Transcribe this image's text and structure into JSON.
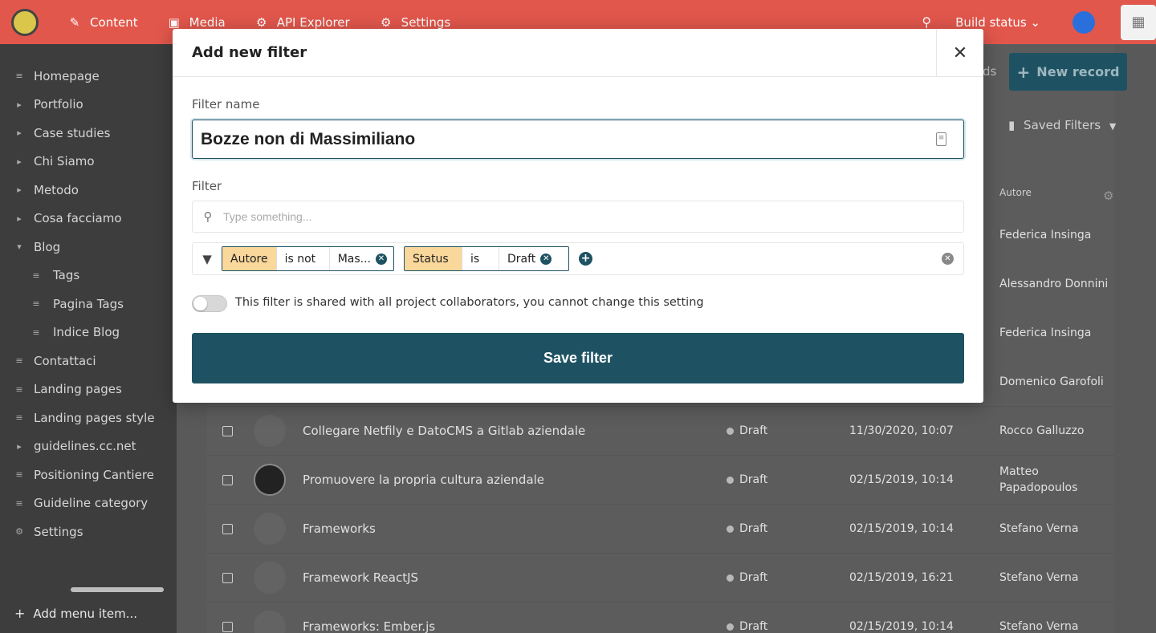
{
  "topbar": {
    "nav": [
      {
        "label": "Content",
        "icon": "content-icon"
      },
      {
        "label": "Media",
        "icon": "media-icon"
      },
      {
        "label": "API Explorer",
        "icon": "api-explorer-icon"
      },
      {
        "label": "Settings",
        "icon": "settings-icon"
      }
    ],
    "build_status": "Build status"
  },
  "sidebar": {
    "items": [
      {
        "label": "Homepage",
        "marker": "≡"
      },
      {
        "label": "Portfolio",
        "marker": "▸"
      },
      {
        "label": "Case studies",
        "marker": "▸"
      },
      {
        "label": "Chi Siamo",
        "marker": "▸"
      },
      {
        "label": "Metodo",
        "marker": "▸"
      },
      {
        "label": "Cosa facciamo",
        "marker": "▸"
      },
      {
        "label": "Blog",
        "marker": "▾"
      },
      {
        "label": "Tags",
        "marker": "≡",
        "sub": true
      },
      {
        "label": "Pagina Tags",
        "marker": "≡",
        "sub": true
      },
      {
        "label": "Indice Blog",
        "marker": "≡",
        "sub": true
      },
      {
        "label": "Contattaci",
        "marker": "≡"
      },
      {
        "label": "Landing pages",
        "marker": "≡"
      },
      {
        "label": "Landing pages style",
        "marker": "≡"
      },
      {
        "label": "guidelines.cc.net",
        "marker": "▸"
      },
      {
        "label": "Positioning Cantiere",
        "marker": "≡"
      },
      {
        "label": "Guideline category",
        "marker": "≡"
      },
      {
        "label": "Settings",
        "marker": "⚙"
      }
    ],
    "add_menu_item": "Add menu item..."
  },
  "main": {
    "new_record": "New record",
    "saved_filters": "Saved Filters",
    "column_autore": "Autore",
    "partial_text": "ds",
    "authors_behind": [
      "Federica Insinga",
      "Alessandro Donnini",
      "Federica Insinga",
      "Domenico Garofoli"
    ],
    "rows": [
      {
        "title": "Collegare Netfily e DatoCMS a Gitlab aziendale",
        "status": "Draft",
        "date": "11/30/2020, 10:07",
        "author": "Rocco Galluzzo",
        "thumb": false
      },
      {
        "title": "Promuovere la propria cultura aziendale",
        "status": "Draft",
        "date": "02/15/2019, 10:14",
        "author": "Matteo Papadopoulos",
        "thumb": true
      },
      {
        "title": "Frameworks",
        "status": "Draft",
        "date": "02/15/2019, 10:14",
        "author": "Stefano Verna",
        "thumb": false
      },
      {
        "title": "Framework ReactJS",
        "status": "Draft",
        "date": "02/15/2019, 16:21",
        "author": "Stefano Verna",
        "thumb": false
      },
      {
        "title": "Frameworks: Ember.js",
        "status": "Draft",
        "date": "02/15/2019, 10:14",
        "author": "Stefano Verna",
        "thumb": false
      }
    ]
  },
  "modal": {
    "title": "Add new filter",
    "filter_name_label": "Filter name",
    "filter_name_value": "Bozze non di Massimiliano",
    "filter_label": "Filter",
    "search_placeholder": "Type something...",
    "conditions": [
      {
        "field": "Autore",
        "operator": "is not",
        "value": "Mas..."
      },
      {
        "field": "Status",
        "operator": "is",
        "value": "Draft"
      }
    ],
    "shared_toggle_label": "This filter is shared with all project collaborators, you cannot change this setting",
    "save_label": "Save filter"
  },
  "colors": {
    "accent": "#1e5263",
    "chip_field": "#fad79a",
    "topbar": "#e2574c"
  }
}
